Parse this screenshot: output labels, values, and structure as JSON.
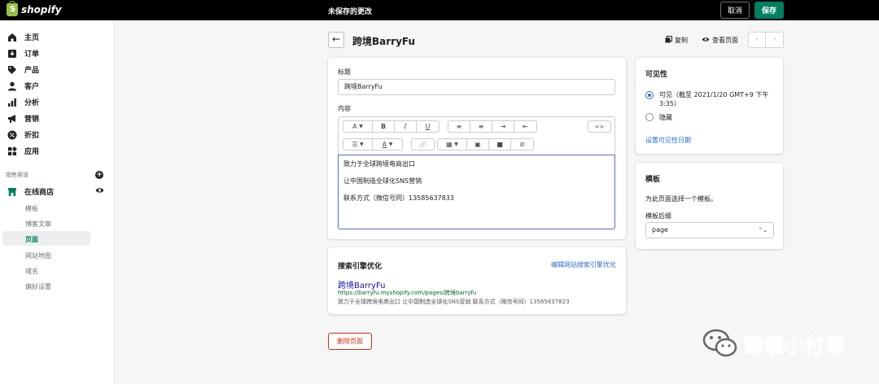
{
  "topbar": {
    "logo_text": "shopify",
    "logo_glyph": "S",
    "unsaved_text": "未保存的更改",
    "cancel_label": "取消",
    "save_label": "保存"
  },
  "sidebar": {
    "items": [
      {
        "label": "主页",
        "icon": "home-icon"
      },
      {
        "label": "订单",
        "icon": "orders-icon"
      },
      {
        "label": "产品",
        "icon": "tag-icon"
      },
      {
        "label": "客户",
        "icon": "person-icon"
      },
      {
        "label": "分析",
        "icon": "bar-chart-icon"
      },
      {
        "label": "营销",
        "icon": "megaphone-icon"
      },
      {
        "label": "折扣",
        "icon": "discount-icon"
      },
      {
        "label": "应用",
        "icon": "apps-icon"
      }
    ],
    "sales_channels_heading": "销售渠道",
    "online_store_label": "在线商店",
    "sub_items": [
      "模板",
      "博客文章",
      "页面",
      "网站地图",
      "域名",
      "偏好设置"
    ],
    "active_sub_item": "页面"
  },
  "page_header": {
    "title": "跨境BarryFu",
    "duplicate_label": "复制",
    "view_page_label": "查看页面",
    "prev_glyph": "‹",
    "next_glyph": "›"
  },
  "content_card": {
    "title_label": "标题",
    "title_value": "跨境BarryFu",
    "content_label": "内容",
    "toolbar_row1": [
      "A",
      "B",
      "I",
      "U",
      "≡",
      "≡",
      "⇥",
      "⇤",
      "<>"
    ],
    "editor_lines": [
      "致力于全球跨境电商出口",
      "让中国制造全球化SNS营销",
      "联系方式（微信号同）13585637833"
    ]
  },
  "seo_card": {
    "heading": "搜索引擎优化",
    "edit_link": "编辑网站搜索引擎优化",
    "preview_title": "跨境BarryFu",
    "preview_url": "https://barryfu.myshopify.com/pages/跨境barryfu",
    "preview_description": "致力于全球跨境电商出口 让中国制造全球化SNS营销 联系方式（微信号同）13585637823"
  },
  "visibility_card": {
    "heading": "可见性",
    "option_visible": "可见（截至 2021/1/20 GMT+9 下午 3:35）",
    "option_hidden": "隐藏",
    "selected": "visible",
    "set_date_link": "设置可见性日期"
  },
  "template_card": {
    "heading": "模板",
    "description": "为此页面选择一个模板。",
    "suffix_label": "模板后缀",
    "suffix_value": "page",
    "select_arrows": "⌃⌄"
  },
  "delete_label": "删除页面",
  "watermark_text": "跨境小付哥",
  "colors": {
    "topbar": "#000000",
    "primary": "#008060",
    "link": "#2c6ecb",
    "danger": "#d82c0d",
    "seo_title": "#1a0dab",
    "seo_url": "#006621"
  }
}
